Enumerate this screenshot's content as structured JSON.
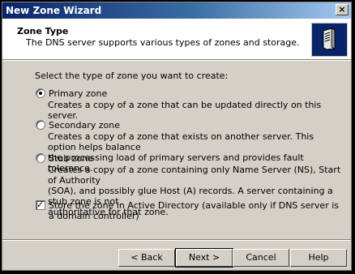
{
  "window": {
    "title": "New Zone Wizard",
    "close_glyph": "×"
  },
  "header": {
    "title": "Zone Type",
    "subtitle": "The DNS server supports various types of zones and storage.",
    "icon": "server-icon"
  },
  "prompt": "Select the type of zone you want to create:",
  "options": [
    {
      "label": "Primary zone",
      "selected": true,
      "description": [
        "Creates a copy of a zone that can be updated directly on this server."
      ]
    },
    {
      "label": "Secondary zone",
      "selected": false,
      "description": [
        "Creates a copy of a zone that exists on another server. This option helps balance",
        "the processing load of primary servers and provides fault tolerance."
      ]
    },
    {
      "label": "Stub zone",
      "selected": false,
      "description": [
        "Creates a copy of a zone containing only Name Server (NS), Start of Authority",
        "(SOA), and possibly glue Host (A) records. A server containing a stub zone is not",
        "authoritative for that zone."
      ]
    }
  ],
  "store_checkbox": {
    "label": "Store the zone in Active Directory (available only if DNS server is a domain controller)",
    "checked": true
  },
  "buttons": {
    "back": "< Back",
    "next": "Next >",
    "cancel": "Cancel",
    "help": "Help"
  },
  "colors": {
    "titlebar": "#0a246a",
    "face": "#d4d0c8"
  }
}
